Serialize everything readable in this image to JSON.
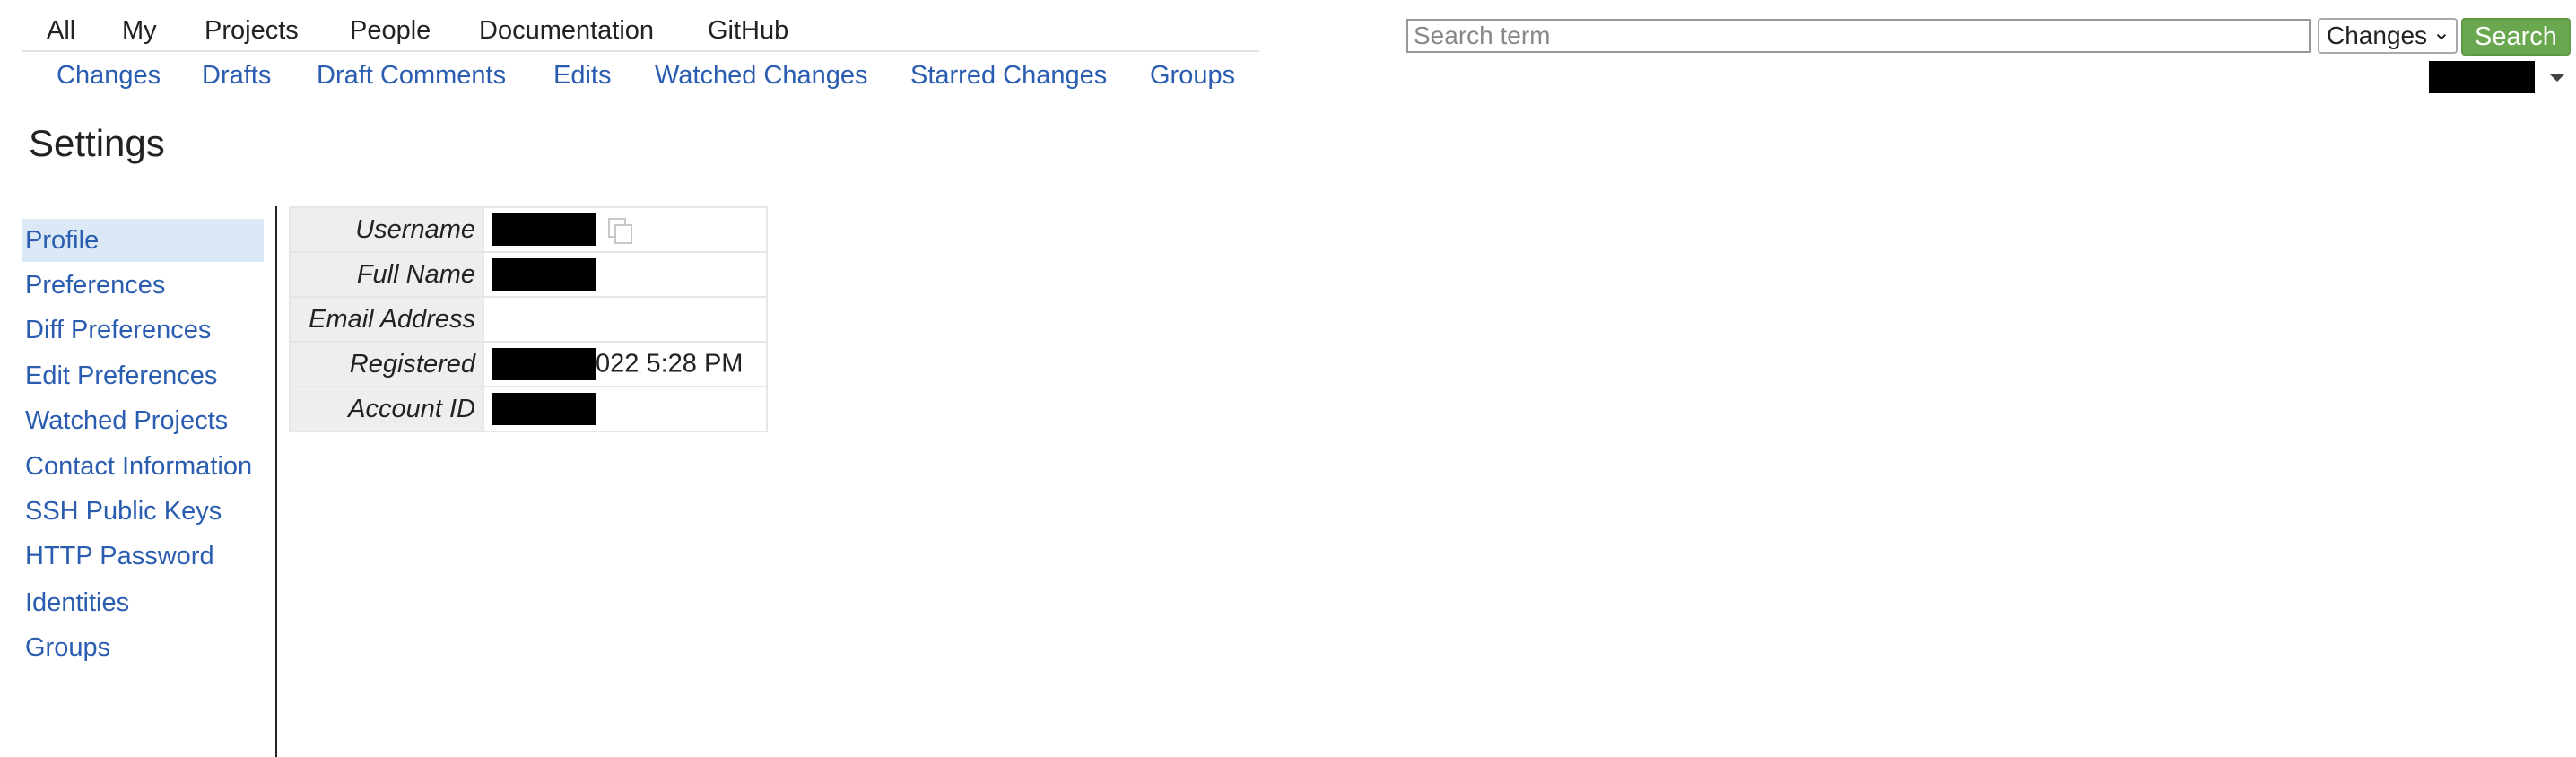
{
  "top_menu": [
    "All",
    "My",
    "Projects",
    "People",
    "Documentation",
    "GitHub"
  ],
  "sub_menu": [
    "Changes",
    "Drafts",
    "Draft Comments",
    "Edits",
    "Watched Changes",
    "Starred Changes",
    "Groups"
  ],
  "search": {
    "placeholder": "Search term",
    "value": "",
    "scope": "Changes",
    "button_label": "Search"
  },
  "page_title": "Settings",
  "side_nav": [
    "Profile",
    "Preferences",
    "Diff Preferences",
    "Edit Preferences",
    "Watched Projects",
    "Contact Information",
    "SSH Public Keys",
    "HTTP Password",
    "Identities",
    "Groups"
  ],
  "side_nav_active": "Profile",
  "profile": {
    "username_label": "Username",
    "fullname_label": "Full Name",
    "email_label": "Email Address",
    "email_value": "",
    "registered_label": "Registered",
    "registered_visible": "022 5:28 PM",
    "account_id_label": "Account ID"
  },
  "icons": [
    "copy-icon",
    "chevron-down-icon",
    "caret-down-icon"
  ],
  "colors": {
    "link": "#2a5db0",
    "search_button": "#6aa84f",
    "active_nav_bg": "#dbe9f6",
    "label_cell_bg": "#eeeeee"
  }
}
